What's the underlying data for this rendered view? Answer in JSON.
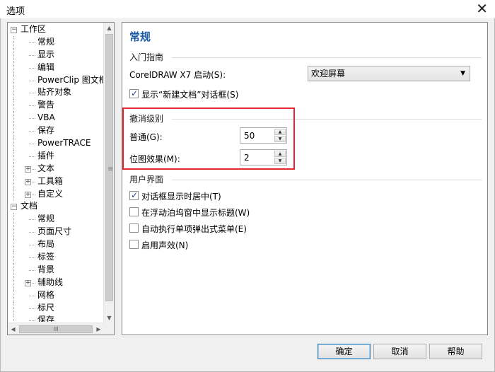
{
  "window": {
    "title": "选项",
    "close_icon": "close-icon"
  },
  "tree": {
    "items": [
      {
        "label": "工作区",
        "level": 0,
        "expander": "−"
      },
      {
        "label": "常规",
        "level": 1
      },
      {
        "label": "显示",
        "level": 1
      },
      {
        "label": "编辑",
        "level": 1
      },
      {
        "label": "PowerClip 图文框",
        "level": 1
      },
      {
        "label": "贴齐对象",
        "level": 1
      },
      {
        "label": "警告",
        "level": 1
      },
      {
        "label": "VBA",
        "level": 1
      },
      {
        "label": "保存",
        "level": 1
      },
      {
        "label": "PowerTRACE",
        "level": 1
      },
      {
        "label": "插件",
        "level": 1
      },
      {
        "label": "文本",
        "level": 1,
        "expander": "+"
      },
      {
        "label": "工具箱",
        "level": 1,
        "expander": "+"
      },
      {
        "label": "自定义",
        "level": 1,
        "expander": "+"
      },
      {
        "label": "文档",
        "level": 0,
        "expander": "−"
      },
      {
        "label": "常规",
        "level": 1
      },
      {
        "label": "页面尺寸",
        "level": 1
      },
      {
        "label": "布局",
        "level": 1
      },
      {
        "label": "标签",
        "level": 1
      },
      {
        "label": "背景",
        "level": 1
      },
      {
        "label": "辅助线",
        "level": 1,
        "expander": "+"
      },
      {
        "label": "网格",
        "level": 1
      },
      {
        "label": "标尺",
        "level": 1
      },
      {
        "label": "保存",
        "level": 1
      }
    ],
    "hscroll_grip": "III",
    "vscroll_grip": "≡"
  },
  "panel": {
    "title": "常规",
    "intro_group": "入门指南",
    "startup_label": "CorelDRAW X7 启动(S):",
    "startup_value": "欢迎屏幕",
    "show_new_doc": {
      "label": "显示“新建文档”对话框(S)",
      "checked": true
    },
    "undo_group": "撤消级别",
    "normal_label": "普通(G):",
    "normal_value": "50",
    "bitmap_label": "位图效果(M):",
    "bitmap_value": "2",
    "ui_group": "用户界面",
    "ui_options": [
      {
        "label": "对话框显示时居中(T)",
        "checked": true
      },
      {
        "label": "在浮动泊坞窗中显示标题(W)",
        "checked": false
      },
      {
        "label": "自动执行单项弹出式菜单(E)",
        "checked": false
      },
      {
        "label": "启用声效(N)",
        "checked": false
      }
    ]
  },
  "buttons": {
    "ok": "确定",
    "cancel": "取消",
    "help": "帮助"
  },
  "colors": {
    "title_blue": "#1a5aa8",
    "highlight_red": "#e4262d"
  }
}
